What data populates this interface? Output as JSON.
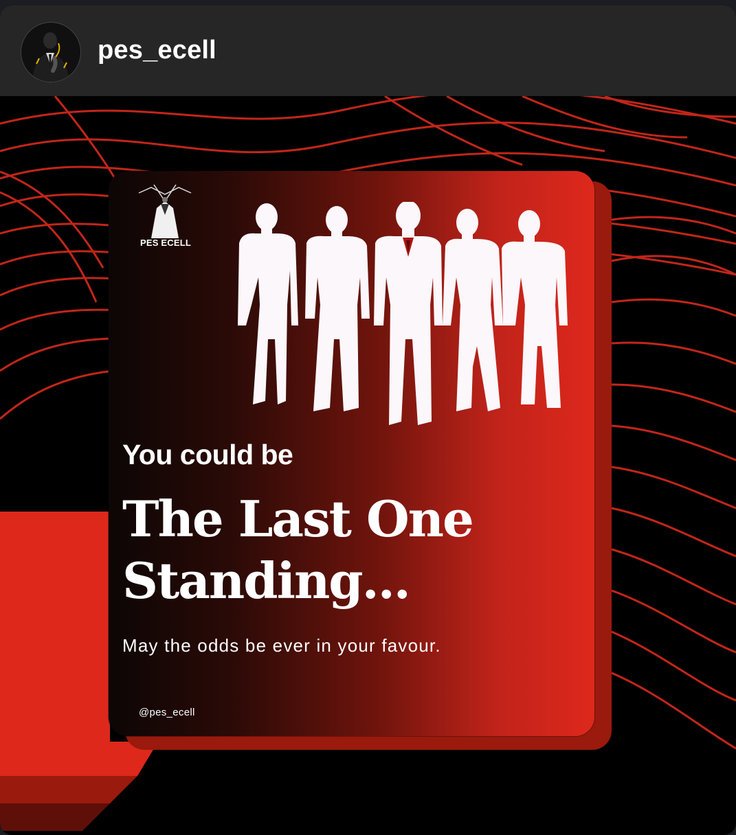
{
  "header": {
    "username": "pes_ecell",
    "avatar_icon": "suited-man-avatar-icon"
  },
  "post": {
    "logo_text": "PES ECELL",
    "intro": "You could be",
    "headline_line1": "The Last One",
    "headline_line2": "Standing...",
    "tagline": "May the odds be ever in your favour.",
    "handle": "@pes_ecell"
  },
  "colors": {
    "header_bg": "#262626",
    "accent_red": "#de281c",
    "wave_red": "#c2261a",
    "background": "#000000"
  }
}
